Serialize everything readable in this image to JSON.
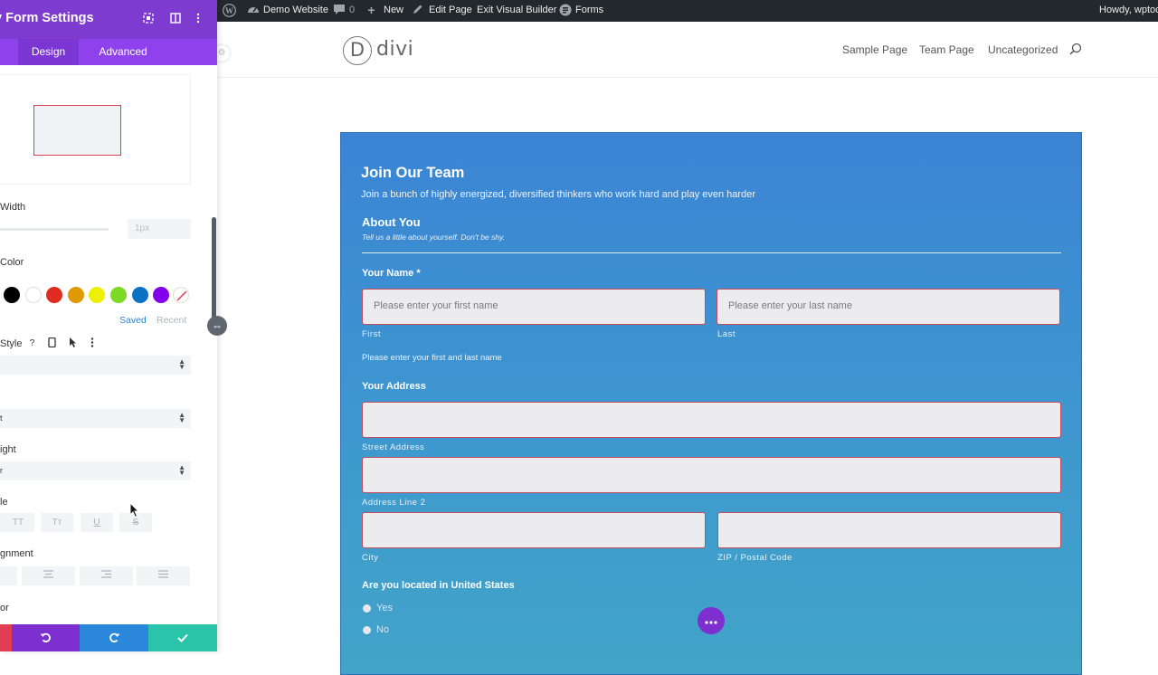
{
  "panel": {
    "title": "y Form Settings",
    "tabs": [
      {
        "label": "Design"
      },
      {
        "label": "Advanced"
      }
    ],
    "labels": {
      "width": "Width",
      "color": "Color",
      "style": "Style",
      "weight": "ight",
      "text_style": "le",
      "alignment": "gnment",
      "color2": "or"
    },
    "width_value": "1px",
    "swatches": [
      "#000000",
      "#ffffff",
      "#e02b20",
      "#e09900",
      "#edf000",
      "#7cda24",
      "#0c71c3",
      "#8300e9"
    ],
    "saved_label": "Saved",
    "recent_label": "Recent",
    "select_values": [
      "",
      "t",
      "r"
    ],
    "text_style_buttons": [
      "TT",
      "Tт",
      "U",
      "S"
    ]
  },
  "adminbar": {
    "site_name": "Demo Website",
    "comments": "0",
    "new": "New",
    "edit_page": "Edit Page",
    "exit_vb": "Exit Visual Builder",
    "forms": "Forms",
    "howdy": "Howdy, wptool"
  },
  "site": {
    "logo_letter": "D",
    "logo_text": "divi",
    "nav": [
      "Sample Page",
      "Team Page",
      "Uncategorized"
    ]
  },
  "form": {
    "title": "Join Our Team",
    "subtitle": "Join a bunch of highly energized, diversified thinkers who work hard and play even harder",
    "section_title": "About You",
    "section_desc": "Tell us a little about yourself. Don't be shy.",
    "name_label": "Your Name",
    "required_mark": "*",
    "first_placeholder": "Please enter your first name",
    "last_placeholder": "Please enter your last name",
    "first_sub": "First",
    "last_sub": "Last",
    "name_help": "Please enter your first and last name",
    "address_label": "Your Address",
    "street_sub": "Street Address",
    "line2_sub": "Address Line 2",
    "city_sub": "City",
    "zip_sub": "ZIP / Postal Code",
    "us_question": "Are you located in United States",
    "options": [
      "Yes",
      "No"
    ]
  }
}
